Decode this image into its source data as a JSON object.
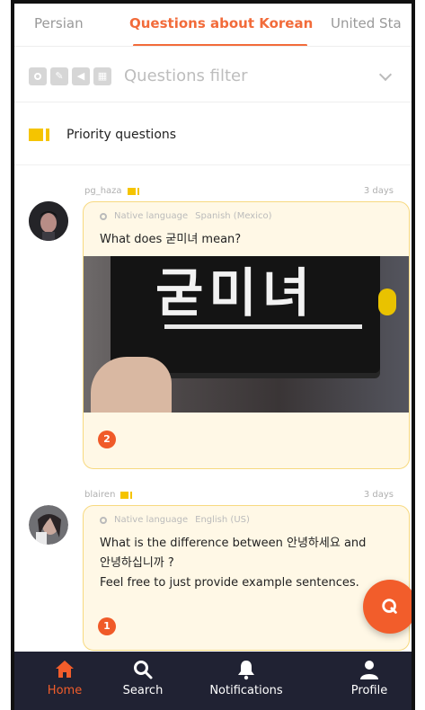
{
  "tabs": [
    "Persian",
    "Questions about Korean",
    "United Sta"
  ],
  "filter": {
    "placeholder": "Questions filter"
  },
  "priority": {
    "label": "Priority questions"
  },
  "posts": [
    {
      "username": "pg_haza",
      "time": "3 days",
      "native_label": "Native language",
      "native_lang": "Spanish (Mexico)",
      "question": "What does 굳미녀 mean?",
      "image_text": "굳미녀",
      "answers": "2"
    },
    {
      "username": "blairen",
      "time": "3 days",
      "native_label": "Native language",
      "native_lang": "English (US)",
      "question_line1": "What is the difference between 안녕하세요  and",
      "question_line2": "안녕하십니까 ?",
      "question_line3": "Feel free to just provide example sentences.",
      "answers": "1"
    }
  ],
  "nav": {
    "home": "Home",
    "search": "Search",
    "notifications": "Notifications",
    "profile": "Profile"
  },
  "colors": {
    "accent": "#f26b3a",
    "navbar": "#202233",
    "card_bg": "#fff8e6",
    "priority_yellow": "#f5c400"
  }
}
